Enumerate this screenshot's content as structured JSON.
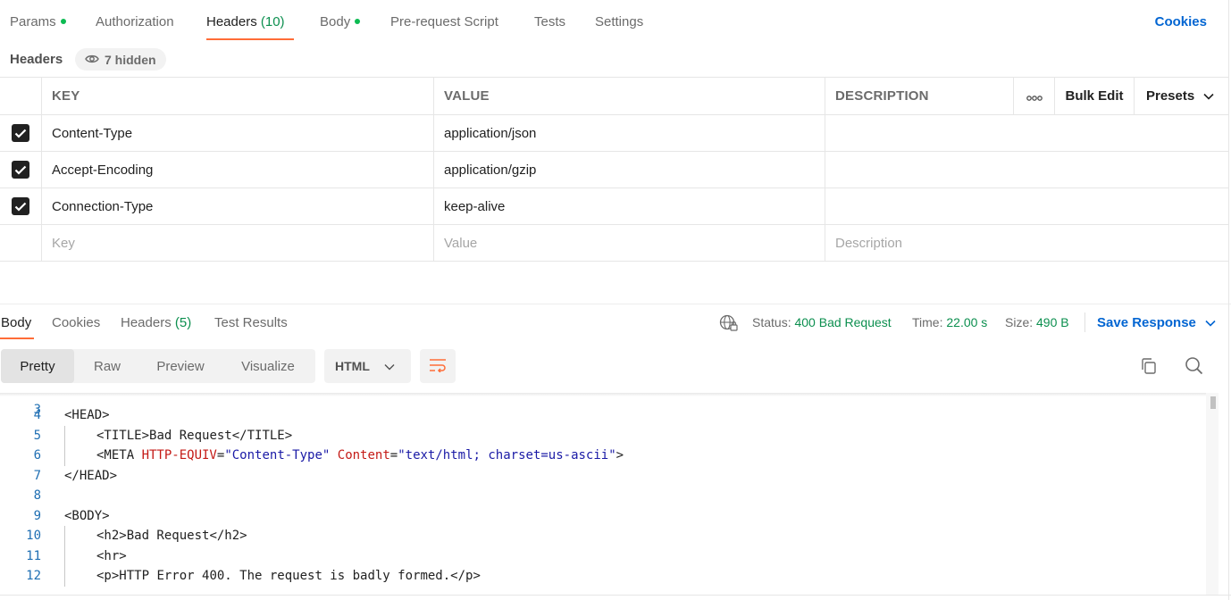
{
  "request_tabs": [
    {
      "label": "Params",
      "dot": true
    },
    {
      "label": "Authorization"
    },
    {
      "label": "Headers",
      "count": "(10)",
      "active": true
    },
    {
      "label": "Body",
      "dot": true
    },
    {
      "label": "Pre-request Script"
    },
    {
      "label": "Tests"
    },
    {
      "label": "Settings"
    }
  ],
  "cookies_label": "Cookies",
  "headers_section": {
    "title": "Headers",
    "hidden_label": "7 hidden"
  },
  "table": {
    "columns": {
      "key": "KEY",
      "value": "VALUE",
      "description": "DESCRIPTION"
    },
    "bulk_edit": "Bulk Edit",
    "presets": "Presets",
    "rows": [
      {
        "checked": true,
        "key": "Content-Type",
        "value": "application/json",
        "description": ""
      },
      {
        "checked": true,
        "key": "Accept-Encoding",
        "value": "application/gzip",
        "description": ""
      },
      {
        "checked": true,
        "key": "Connection-Type",
        "value": "keep-alive",
        "description": ""
      }
    ],
    "placeholders": {
      "key": "Key",
      "value": "Value",
      "description": "Description"
    }
  },
  "response": {
    "tabs": [
      {
        "label": "Body",
        "active": true
      },
      {
        "label": "Cookies"
      },
      {
        "label": "Headers",
        "count": "(5)"
      },
      {
        "label": "Test Results"
      }
    ],
    "status_label": "Status:",
    "status_value": "400 Bad Request",
    "time_label": "Time:",
    "time_value": "22.00 s",
    "size_label": "Size:",
    "size_value": "490 B",
    "save_label": "Save Response"
  },
  "format": {
    "modes": [
      "Pretty",
      "Raw",
      "Preview",
      "Visualize"
    ],
    "active_mode": "Pretty",
    "language": "HTML"
  },
  "code": {
    "partial_line_number": "3",
    "lines": [
      {
        "n": "4",
        "indent": 0,
        "parts": [
          [
            "tag",
            "<HEAD>"
          ]
        ]
      },
      {
        "n": "5",
        "indent": 1,
        "parts": [
          [
            "tag",
            "<TITLE>"
          ],
          [
            "text",
            "Bad Request"
          ],
          [
            "tag",
            "</TITLE>"
          ]
        ]
      },
      {
        "n": "6",
        "indent": 1,
        "parts": [
          [
            "tag",
            "<META "
          ],
          [
            "attr",
            "HTTP-EQUIV"
          ],
          [
            "tag",
            "="
          ],
          [
            "str",
            "\"Content-Type\""
          ],
          [
            "tag",
            " "
          ],
          [
            "attr",
            "Content"
          ],
          [
            "tag",
            "="
          ],
          [
            "str",
            "\"text/html; charset=us-ascii\""
          ],
          [
            "tag",
            ">"
          ]
        ]
      },
      {
        "n": "7",
        "indent": 0,
        "parts": [
          [
            "tag",
            "</HEAD>"
          ]
        ]
      },
      {
        "n": "8",
        "indent": 0,
        "parts": []
      },
      {
        "n": "9",
        "indent": 0,
        "parts": [
          [
            "tag",
            "<BODY>"
          ]
        ]
      },
      {
        "n": "10",
        "indent": 1,
        "parts": [
          [
            "tag",
            "<h2>"
          ],
          [
            "text",
            "Bad Request"
          ],
          [
            "tag",
            "</h2>"
          ]
        ]
      },
      {
        "n": "11",
        "indent": 1,
        "parts": [
          [
            "tag",
            "<hr>"
          ]
        ]
      },
      {
        "n": "12",
        "indent": 1,
        "parts": [
          [
            "tag",
            "<p>"
          ],
          [
            "text",
            "HTTP Error 400. The request is badly formed."
          ],
          [
            "tag",
            "</p>"
          ]
        ]
      }
    ]
  },
  "colors": {
    "accent": "#ff6c37",
    "link": "#0265d2",
    "success": "#0c8f4f"
  },
  "icons": {
    "eye": "eye-icon",
    "more": "more-horizontal-icon",
    "chevron": "chevron-down-icon",
    "globe": "globe-lock-icon",
    "wrap": "word-wrap-icon",
    "copy": "copy-icon",
    "search": "search-icon"
  }
}
